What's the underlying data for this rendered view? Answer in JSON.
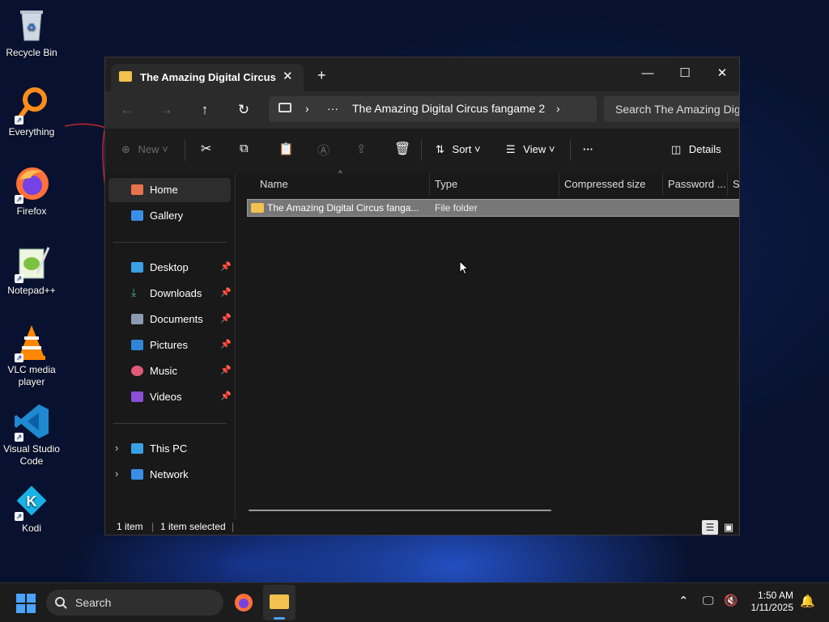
{
  "desktop": {
    "icons": [
      {
        "label": "Recycle Bin",
        "icon": "recycle-bin-icon"
      },
      {
        "label": "Everything",
        "icon": "everything-icon"
      },
      {
        "label": "Firefox",
        "icon": "firefox-icon"
      },
      {
        "label": "Notepad++",
        "icon": "notepad-plus-plus-icon"
      },
      {
        "label": "VLC media player",
        "icon": "vlc-icon"
      },
      {
        "label": "Visual Studio Code",
        "icon": "vscode-icon"
      },
      {
        "label": "Kodi",
        "icon": "kodi-icon"
      }
    ]
  },
  "window": {
    "tab_title": "The Amazing Digital Circus far",
    "new_tab": "+",
    "controls": {
      "minimize": "—",
      "maximize": "☐",
      "close": "✕"
    },
    "address": {
      "more": "···",
      "segment": "The Amazing Digital Circus fangame 2",
      "chevron": "›"
    },
    "search_placeholder": "Search The Amazing Digi",
    "commands": {
      "new": "New",
      "sort": "Sort",
      "view": "View",
      "more": "···",
      "details": "Details"
    },
    "nav": {
      "home": "Home",
      "gallery": "Gallery",
      "desktop": "Desktop",
      "downloads": "Downloads",
      "documents": "Documents",
      "pictures": "Pictures",
      "music": "Music",
      "videos": "Videos",
      "this_pc": "This PC",
      "network": "Network"
    },
    "columns": [
      "Name",
      "Type",
      "Compressed size",
      "Password ...",
      "Si"
    ],
    "rows": [
      {
        "name": "The Amazing Digital Circus fanga...",
        "type": "File folder"
      }
    ],
    "status": {
      "count": "1 item",
      "selected": "1 item selected"
    }
  },
  "taskbar": {
    "search": "Search",
    "time": "1:50 AM",
    "date": "1/11/2025"
  },
  "colors": {
    "folder": "#f2c14e",
    "accent": "#4aa3ff"
  }
}
